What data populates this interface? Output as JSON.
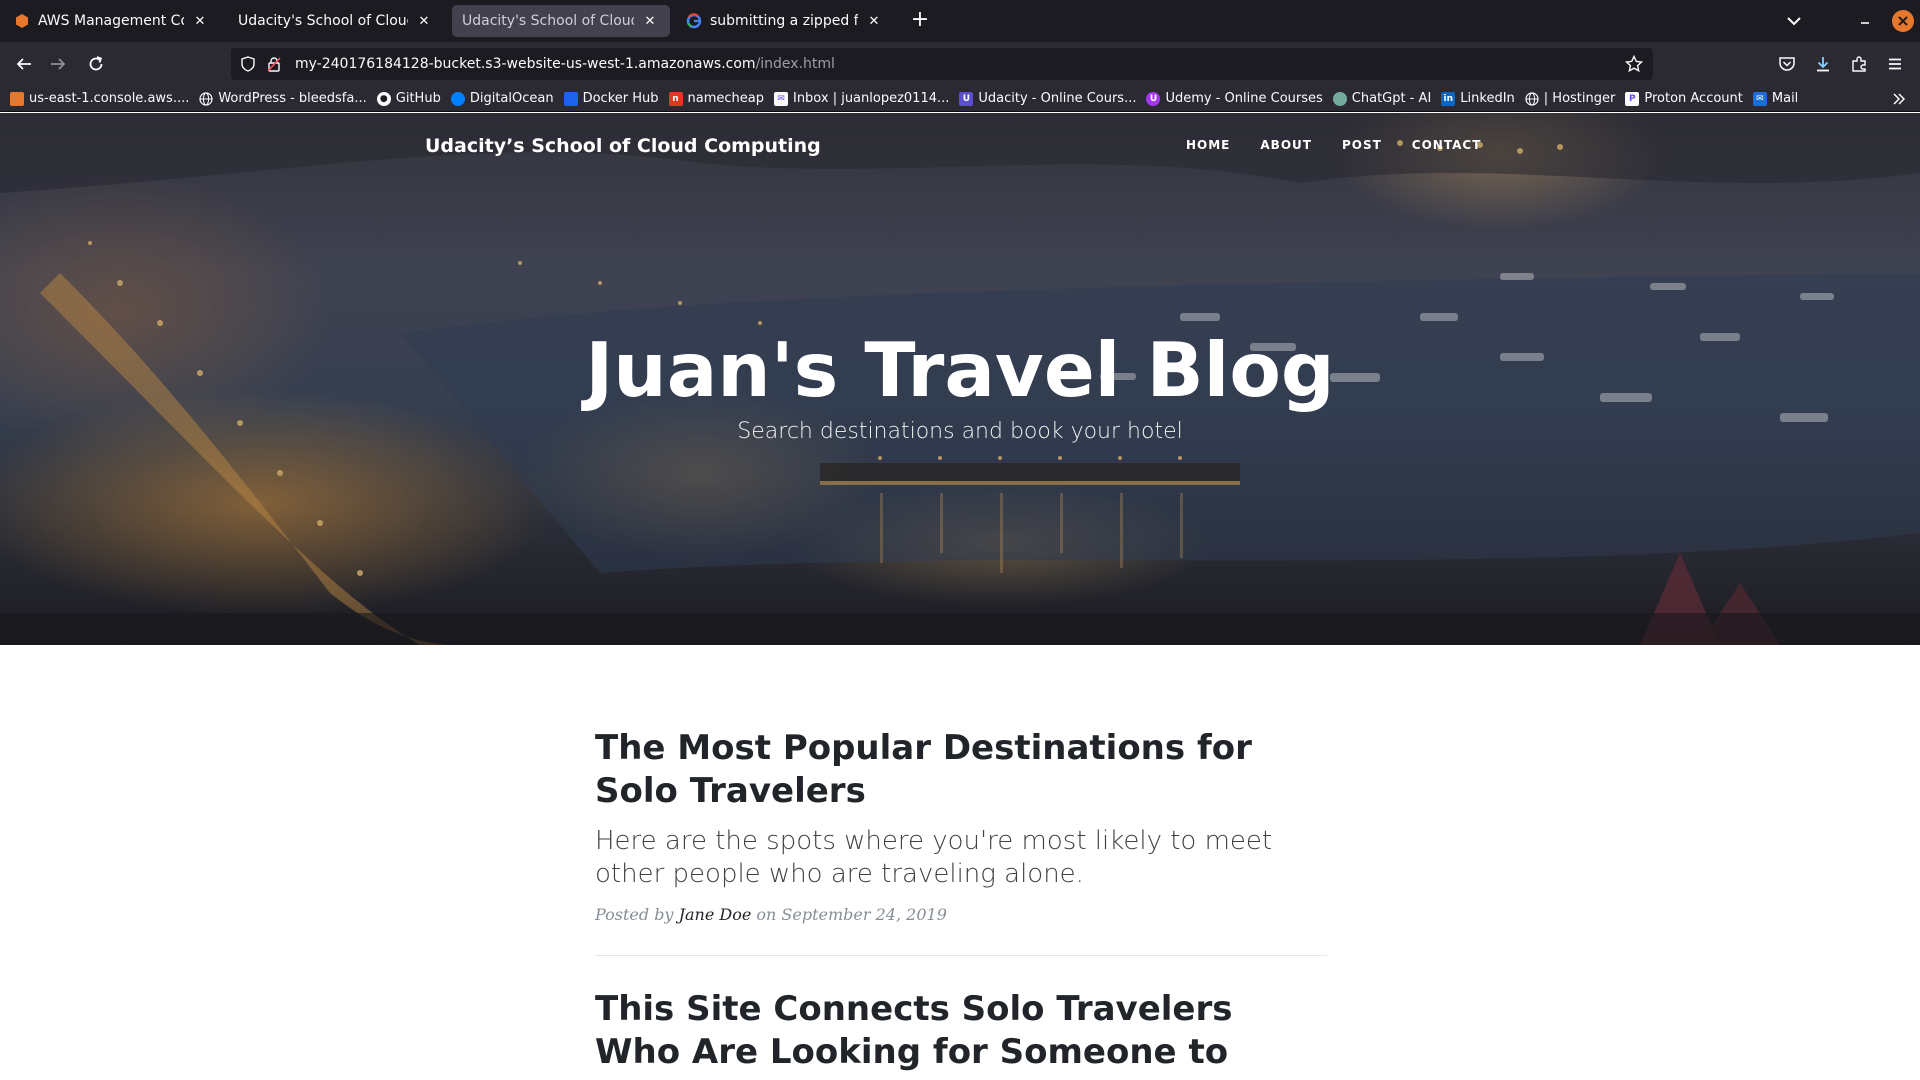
{
  "browser": {
    "tabs": [
      {
        "label": "AWS Management Console",
        "icon": "aws-icon"
      },
      {
        "label": "Udacity's School of Cloud Comp",
        "icon": ""
      },
      {
        "label": "Udacity's School of Cloud Comp",
        "icon": "",
        "active": true
      },
      {
        "label": "submitting a zipped folder",
        "icon": "google-icon"
      }
    ],
    "url_main": "my-240176184128-bucket.s3-website-us-west-1.amazonaws.com",
    "url_path": "/index.html",
    "bookmarks": [
      {
        "label": "us-east-1.console.aws....",
        "icon": "aws-icon",
        "color": "#e8772e"
      },
      {
        "label": "WordPress - bleedsfa...",
        "icon": "globe-icon",
        "color": ""
      },
      {
        "label": "GitHub",
        "icon": "github-icon",
        "color": ""
      },
      {
        "label": "DigitalOcean",
        "icon": "digitalocean-icon",
        "color": "#0080ff"
      },
      {
        "label": "Docker Hub",
        "icon": "docker-icon",
        "color": ""
      },
      {
        "label": "namecheap",
        "icon": "namecheap-icon",
        "color": "#de3723"
      },
      {
        "label": "Inbox | juanlopez0114...",
        "icon": "mail-icon",
        "color": "#6d4aff"
      },
      {
        "label": "Udacity - Online Cours...",
        "icon": "udacity-icon",
        "color": "#5a4fcf"
      },
      {
        "label": "Udemy - Online Courses",
        "icon": "udemy-icon",
        "color": "#a435f0"
      },
      {
        "label": "ChatGpt - AI",
        "icon": "chatgpt-icon",
        "color": "#74aa9c"
      },
      {
        "label": "LinkedIn",
        "icon": "linkedin-icon",
        "color": "#0a66c2"
      },
      {
        "label": "| Hostinger",
        "icon": "globe-icon",
        "color": ""
      },
      {
        "label": "Proton Account",
        "icon": "proton-icon",
        "color": "#6d4aff"
      },
      {
        "label": "Mail",
        "icon": "mail-icon",
        "color": "#1b6dd8"
      }
    ]
  },
  "site": {
    "brand": "Udacity’s School of Cloud Computing",
    "nav": [
      "HOME",
      "ABOUT",
      "POST",
      "CONTACT"
    ],
    "hero_title": "Juan's Travel Blog",
    "hero_subtitle": "Search destinations and book your hotel"
  },
  "posts": [
    {
      "title": "The Most Popular Destinations for Solo Travelers",
      "subtitle": "Here are the spots where you're most likely to meet other people who are traveling alone.",
      "meta_prefix": "Posted by",
      "author": "Jane Doe",
      "meta_date": "on September 24, 2019"
    },
    {
      "title": "This Site Connects Solo Travelers Who Are Looking for Someone to Travel and"
    }
  ]
}
